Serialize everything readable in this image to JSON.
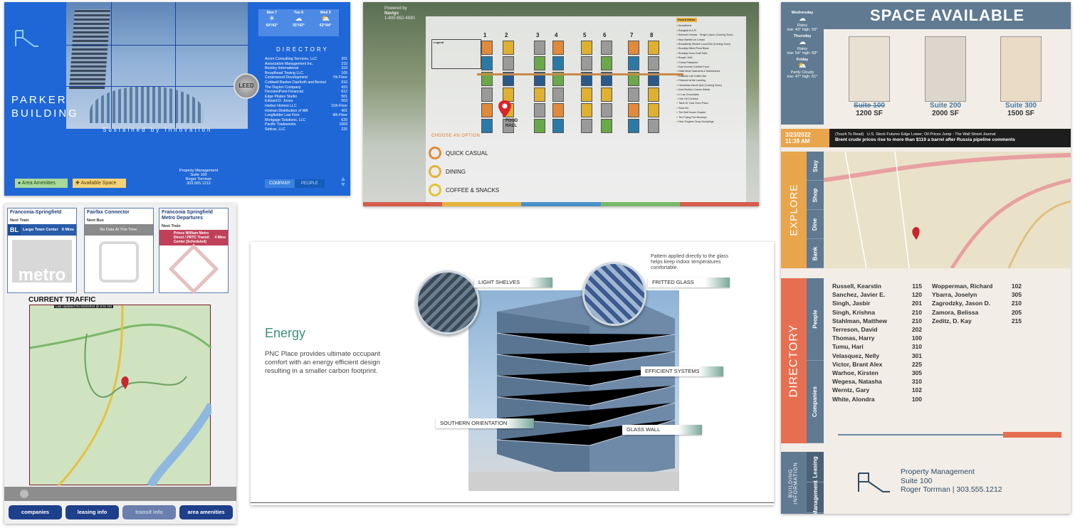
{
  "parker": {
    "title_line1": "PARKER",
    "title_line2": "BUILDING",
    "tagline": "Sustained by Innovation",
    "leed": "LEED",
    "weather": [
      {
        "day": "Mon 7",
        "icon": "☀",
        "temp": "60°/42°"
      },
      {
        "day": "Tue 8",
        "icon": "☁",
        "temp": "55°/42°"
      },
      {
        "day": "Wed 9",
        "icon": "⛅",
        "temp": "62°/44°"
      }
    ],
    "directory_heading": "DIRECTORY",
    "directory": [
      {
        "name": "Acorn Consulting Services, LLC",
        "suite": "201"
      },
      {
        "name": "Association Management Inc.",
        "suite": "215"
      },
      {
        "name": "Bentley International",
        "suite": "310"
      },
      {
        "name": "Broadhead Towing LLC",
        "suite": "105"
      },
      {
        "name": "Centerwood Development",
        "suite": "7th Floor"
      },
      {
        "name": "Coldwell Banker Danforth and Beckel",
        "suite": "610"
      },
      {
        "name": "The Dayton Company",
        "suite": "415"
      },
      {
        "name": "DecisionPoint Financial",
        "suite": "612"
      },
      {
        "name": "Edge Pilates Studio",
        "suite": "501"
      },
      {
        "name": "Edward D. Jones",
        "suite": "503"
      },
      {
        "name": "Harbor Homes LLC",
        "suite": "11th Floor"
      },
      {
        "name": "Holman Distribution of WA",
        "suite": "401"
      },
      {
        "name": "Longfielder Law Firm",
        "suite": "9th Floor"
      },
      {
        "name": "Mortgage Solutions, LLC",
        "suite": "620"
      },
      {
        "name": "Pacific Tradeworks",
        "suite": "1003"
      },
      {
        "name": "Settrax, LLC",
        "suite": "225"
      }
    ],
    "pm_lines": [
      "Property Management",
      "Suite 100",
      "Roger Torrman",
      "303.555.1212"
    ],
    "area_amenities": "Area Amenities",
    "available_space": "Available Space",
    "tab_company": "COMPANY",
    "tab_people": "PEOPLE"
  },
  "mall": {
    "brand": "Powered by",
    "brand2": "Navigo",
    "phone": "1-800-652-4830",
    "legend_label": "Legend",
    "columns": [
      "1",
      "2",
      "3",
      "4",
      "5",
      "6",
      "7",
      "8"
    ],
    "food_hall_1": "FOOD",
    "food_hall_2": "HALL",
    "choose": "CHOOSE AN OPTION",
    "options": [
      "QUICK CASUAL",
      "DINING",
      "COFFEE & SNACKS"
    ],
    "list_heading": "Food & Drinks",
    "list": [
      "Amoutheris",
      "Bangkok B.A.R.",
      "Barrow's Homes · Ginger Liquor (Coming Soon)",
      "Blue Marble Ice Cream",
      "Broadberry Kitchen Local Deli (Coming Soon)",
      "Brooklyn Bites Pizza Black",
      "Brooklyn Kura Craft Sake",
      "Burger Joint",
      "Cobos Patisserie",
      "Epic Korean Comfort Food",
      "Dallo Meat Salumeria & Sandwiches",
      "Eastside Lab Coffee Bar",
      "Filament at the Landing",
      "Hometown Bar-B-Que (Coming Soon)",
      "Kind Brother Cranes Kebab",
      "Li Lac Chocolates",
      "One Girl Cookies",
      "Table 87 Coal Oven Pizza",
      "Sava Mo",
      "The Bell House Chapter",
      "The Frying Pan Brooklyn",
      "New Toughen Soup Dumplings"
    ]
  },
  "space": {
    "banner": "SPACE AVAILABLE",
    "weather": [
      {
        "day": "Wednesday",
        "cond": "Rainy",
        "temp": "low: 43° high: 55°"
      },
      {
        "day": "Thursday",
        "cond": "Rainy",
        "temp": "low: 54° high: 68°"
      },
      {
        "day": "Friday",
        "cond": "Partly Cloudy",
        "temp": "low: 47° high: 61°"
      }
    ],
    "suites": [
      {
        "name": "Suite 100",
        "sf": "1200 SF"
      },
      {
        "name": "Suite 200",
        "sf": "2000 SF"
      },
      {
        "name": "Suite 300",
        "sf": "1500 SF"
      }
    ],
    "date": "3/23/2022",
    "time": "11:39 AM",
    "news1": "(Touch To Read)",
    "news_head": "U.S. Stock Futures Edge Lower; Oil Prices Jump - The Wall Street Journal",
    "news2": "Brent crude prices rise to more than $119 a barrel after Russia pipeline comments",
    "explore": "EXPLORE",
    "explore_tabs": [
      "Stay",
      "Shop",
      "Dine",
      "Bank"
    ],
    "directory": "DIRECTORY",
    "dir_tabs": [
      "People",
      "Companies"
    ],
    "people_left": [
      {
        "n": "Russell, Kearstin",
        "s": "115"
      },
      {
        "n": "Sanchez, Javier E.",
        "s": "120"
      },
      {
        "n": "Singh, Jasbir",
        "s": "201"
      },
      {
        "n": "Singh, Krishna",
        "s": "210"
      },
      {
        "n": "Stahlman, Matthew",
        "s": "210"
      },
      {
        "n": "Terreson, David",
        "s": "202"
      },
      {
        "n": "Thomas, Harry",
        "s": "100"
      },
      {
        "n": "Tumu, Hari",
        "s": "310"
      },
      {
        "n": "Velasquez, Nelly",
        "s": "301"
      },
      {
        "n": "Victor, Brant Alex",
        "s": "225"
      },
      {
        "n": "Warhoe, Kirsten",
        "s": "305"
      },
      {
        "n": "Wegesa, Natasha",
        "s": "310"
      },
      {
        "n": "Werntz, Gary",
        "s": "102"
      },
      {
        "n": "White, Alondra",
        "s": "100"
      }
    ],
    "people_right": [
      {
        "n": "Wopperman, Richard",
        "s": "102"
      },
      {
        "n": "Ybarra, Joselyn",
        "s": "305"
      },
      {
        "n": "Zagrodzky, Jason D.",
        "s": "210"
      },
      {
        "n": "Zamora, Belissa",
        "s": "205"
      },
      {
        "n": "Zeditz, D. Kay",
        "s": "215"
      }
    ],
    "bldg_info": "BUILDING INFORMATION",
    "bi_tabs": [
      "Leasing",
      "Management"
    ],
    "pm": [
      "Property Management",
      "Suite 100",
      "Roger Torrman | 303.555.1212"
    ]
  },
  "transit": {
    "box1_title": "Franconia-Springfield",
    "box1_sub": "Next Train",
    "line": "BL",
    "dest": "Largo Town Center",
    "mins": "6 Mins",
    "metro": "metro",
    "box2_title": "Fairfax Connector",
    "box2_sub": "Next Bus",
    "nodata": "No Data At This Time.",
    "box3_title": "Franconia Springfield Metro Departures",
    "box3_sub": "Next Train",
    "vre_dest": "Prince William Metro Direct / PRTC Transit Center [Scheduled]",
    "vre_mins": "4 Mins",
    "traffic": "CURRENT TRAFFIC",
    "updated": "Last Updated On 6/22/2018 @ 9:31 AM",
    "buttons": [
      "companies",
      "leasing info",
      "transit info",
      "area amenities"
    ]
  },
  "energy": {
    "heading": "Energy",
    "para": "PNC Place provides ultimate occupant comfort with an energy efficient design resulting in a smaller carbon footprint.",
    "note": "Pattern applied directly to the glass helps keep indoor temperatures comfortable.",
    "labels": [
      "LIGHT SHELVES",
      "FRITTED GLASS",
      "EFFICIENT SYSTEMS",
      "SOUTHERN ORIENTATION",
      "GLASS WALL"
    ]
  }
}
